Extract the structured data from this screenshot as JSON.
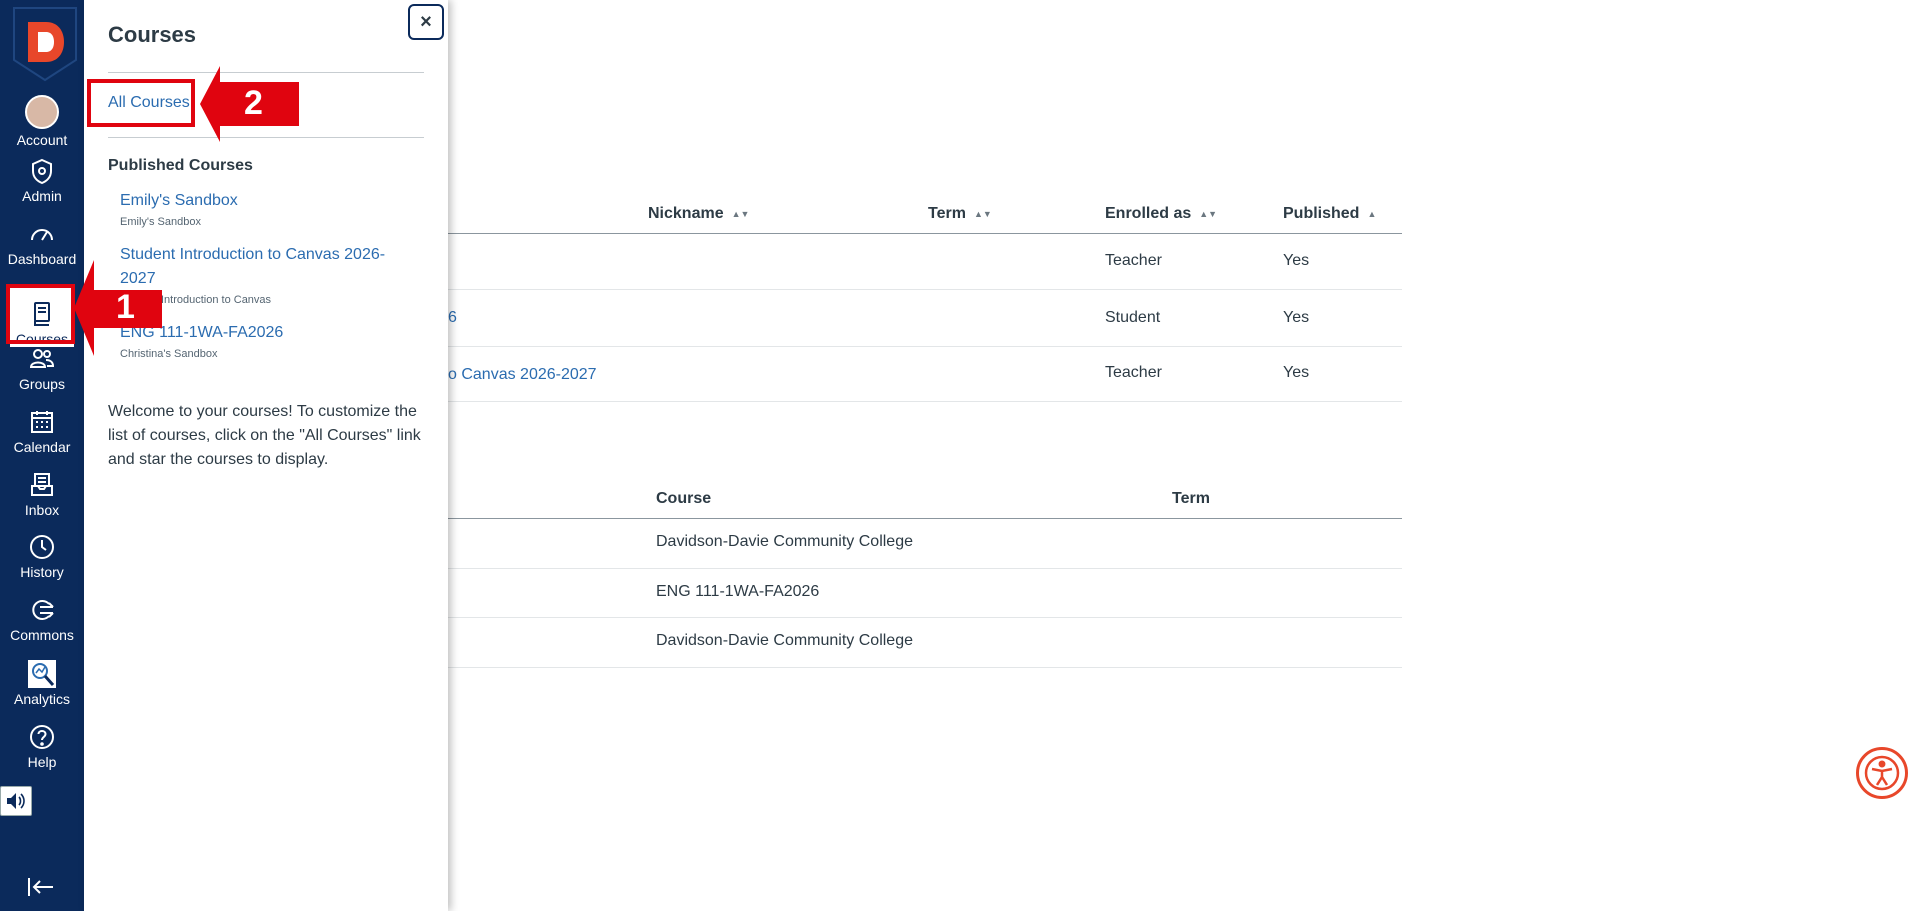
{
  "nav": {
    "account": "Account",
    "admin": "Admin",
    "dashboard": "Dashboard",
    "courses": "Courses",
    "groups": "Groups",
    "calendar": "Calendar",
    "inbox": "Inbox",
    "history": "History",
    "commons": "Commons",
    "analytics": "Analytics",
    "help": "Help"
  },
  "tray": {
    "title": "Courses",
    "close": "×",
    "all_courses": "All Courses",
    "published_heading": "Published Courses",
    "courses": [
      {
        "name": "Emily's Sandbox",
        "sub": "Emily's Sandbox"
      },
      {
        "name": "Student Introduction to Canvas 2026-2027",
        "sub": "Student Introduction to Canvas"
      },
      {
        "name": "ENG 111-1WA-FA2026",
        "sub": "Christina's Sandbox"
      }
    ],
    "welcome": "Welcome to your courses! To customize the list of courses, click on the \"All Courses\" link and star the courses to display."
  },
  "callouts": {
    "one": "1",
    "two": "2"
  },
  "courses_table": {
    "headers": {
      "nickname": "Nickname",
      "term": "Term",
      "enrolled": "Enrolled as",
      "published": "Published"
    },
    "rows": [
      {
        "name": "",
        "enrolled": "Teacher",
        "published": "Yes"
      },
      {
        "name": "6",
        "enrolled": "Student",
        "published": "Yes"
      },
      {
        "name": "o Canvas 2026-2027",
        "enrolled": "Teacher",
        "published": "Yes"
      }
    ]
  },
  "groups_table": {
    "headers": {
      "course": "Course",
      "term": "Term"
    },
    "rows": [
      {
        "course": "Davidson-Davie Community College"
      },
      {
        "course": "ENG 111-1WA-FA2026"
      },
      {
        "course": "Davidson-Davie Community College"
      }
    ]
  },
  "colors": {
    "nav_bg": "#0b2a5b",
    "link": "#2b6cb0",
    "callout_red": "#e0040f",
    "brand_orange": "#e8472a"
  }
}
